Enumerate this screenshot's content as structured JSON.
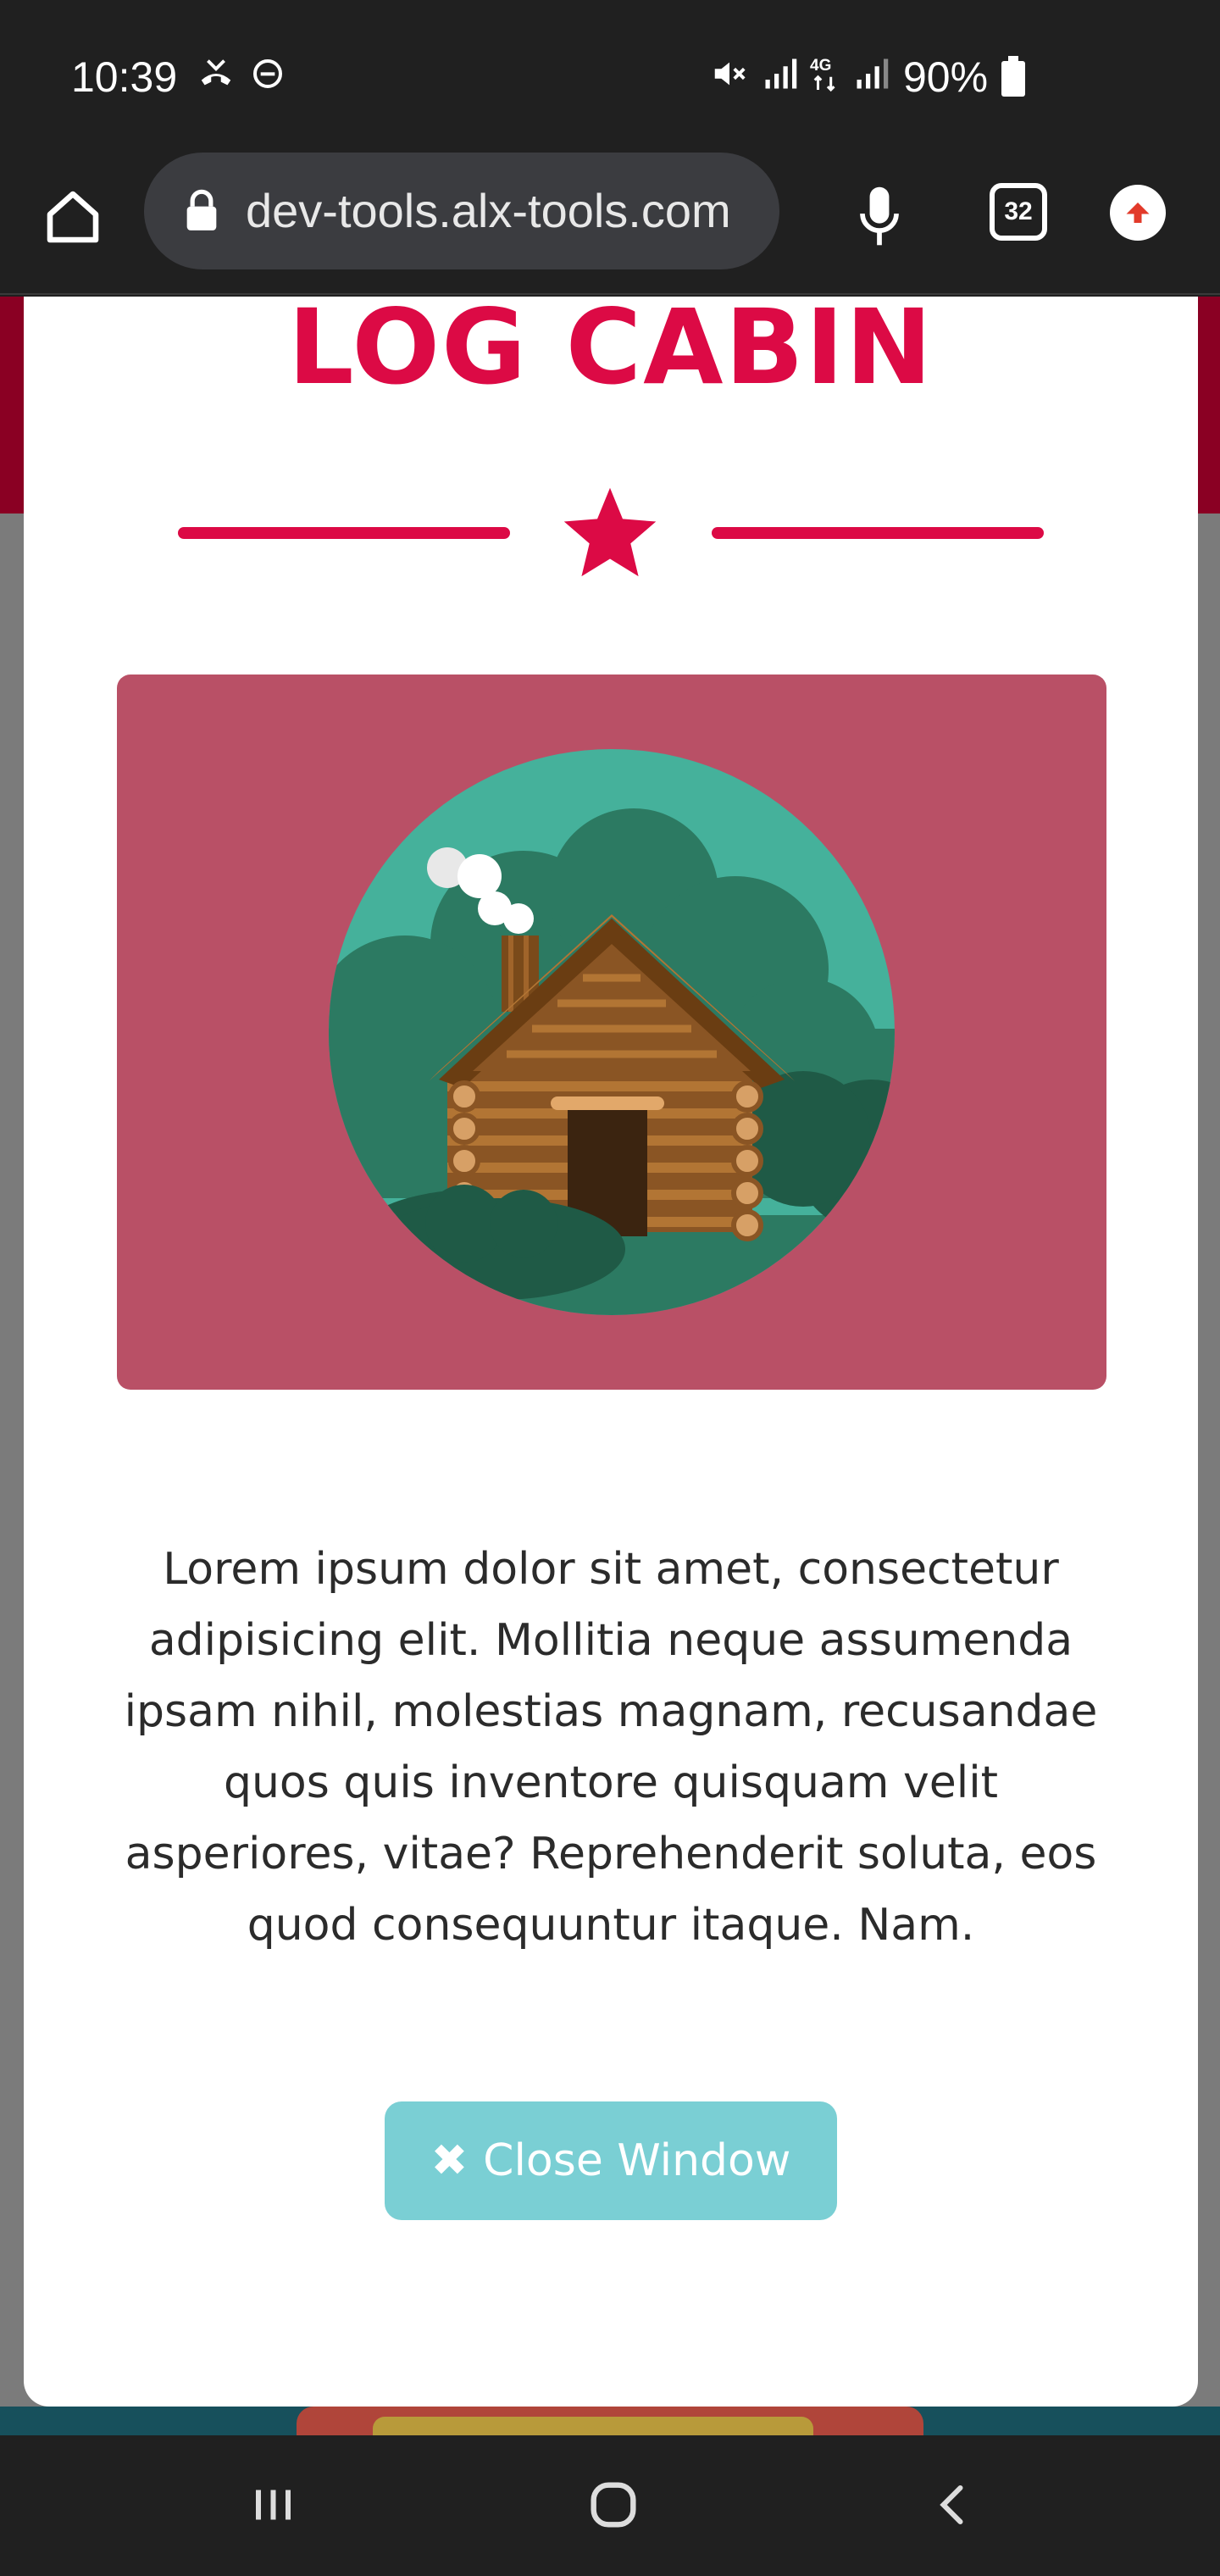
{
  "status_bar": {
    "time": "10:39",
    "battery": "90%",
    "icons": [
      "missed-call-icon",
      "do-not-disturb-icon",
      "mute-icon",
      "signal-icon",
      "4g-icon",
      "signal-icon",
      "battery-icon"
    ]
  },
  "browser": {
    "url": "dev-tools.alx-tools.com",
    "tab_count": "32"
  },
  "modal": {
    "title": "LOG CABIN",
    "body": "Lorem ipsum dolor sit amet, consectetur adipisicing elit. Mollitia neque assumenda ipsam nihil, molestias magnam, recusandae quos quis inventore quisquam velit asperiores, vitae? Reprehenderit soluta, eos quod consequuntur itaque. Nam.",
    "close_label": "Close Window"
  },
  "colors": {
    "accent": "#dc0a45",
    "hero_bg": "#b95066",
    "button_bg": "#7acfd4"
  }
}
